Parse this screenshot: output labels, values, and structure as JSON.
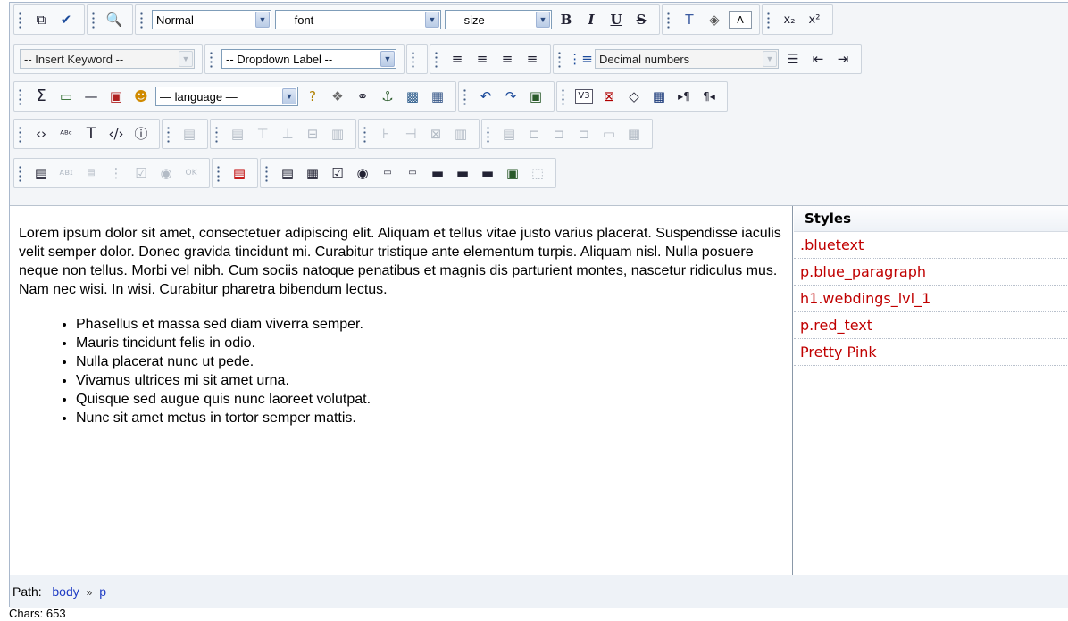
{
  "toolbar": {
    "format_select": "Normal",
    "font_select": "— font —",
    "size_select": "— size —",
    "bold": "B",
    "italic": "I",
    "underline": "U",
    "strike": "S",
    "font_box": "A",
    "keyword_select": "-- Insert Keyword --",
    "dropdown_select": "-- Dropdown Label --",
    "list_style_select": "Decimal numbers",
    "language_select": "— language —",
    "validator": "V3"
  },
  "content": {
    "paragraph": "Lorem ipsum dolor sit amet, consectetuer adipiscing elit. Aliquam et tellus vitae justo varius placerat. Suspendisse iaculis velit semper dolor. Donec gravida tincidunt mi. Curabitur tristique ante elementum turpis. Aliquam nisl. Nulla posuere neque non tellus. Morbi vel nibh. Cum sociis natoque penatibus et magnis dis parturient montes, nascetur ridiculus mus. Nam nec wisi. In wisi. Curabitur pharetra bibendum lectus.",
    "list": [
      "Phasellus et massa sed diam viverra semper.",
      "Mauris tincidunt felis in odio.",
      "Nulla placerat nunc ut pede.",
      "Vivamus ultrices mi sit amet urna.",
      "Quisque sed augue quis nunc laoreet volutpat.",
      "Nunc sit amet metus in tortor semper mattis."
    ]
  },
  "styles": {
    "header": "Styles",
    "items": [
      ".bluetext",
      "p.blue_paragraph",
      "h1.webdings_lvl_1",
      "p.red_text",
      "Pretty Pink"
    ]
  },
  "path": {
    "label": "Path:",
    "items": [
      "body",
      "p"
    ],
    "separator": "»"
  },
  "status": {
    "chars": "Chars: 653"
  }
}
